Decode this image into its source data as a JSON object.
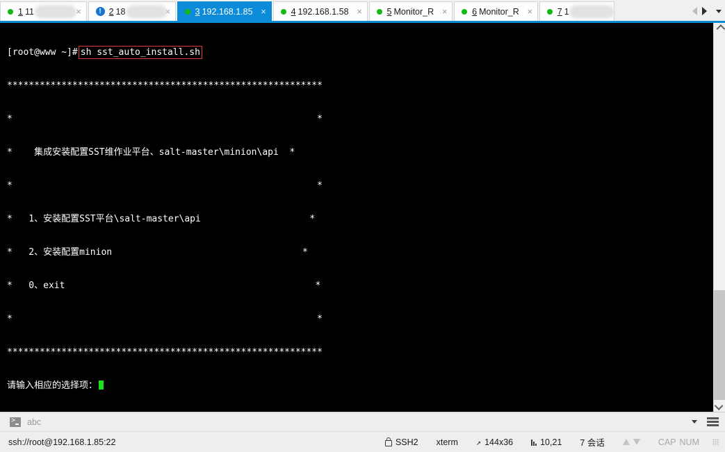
{
  "tabbar": {
    "tabs": [
      {
        "index": "1",
        "label_prefix": "11",
        "label_suffix": ".171",
        "redacted": true,
        "icon": "status-dot-green",
        "close": "×",
        "active": false
      },
      {
        "index": "2",
        "label_prefix": "18",
        "label_suffix": "180",
        "redacted": true,
        "icon": "warning-blue",
        "close": "×",
        "active": false
      },
      {
        "index": "3",
        "label_prefix": "192.168.1.85",
        "label_suffix": "",
        "redacted": false,
        "icon": "status-dot-green",
        "close": "×",
        "active": true
      },
      {
        "index": "4",
        "label_prefix": "192.168.1.58",
        "label_suffix": "",
        "redacted": false,
        "icon": "status-dot-green",
        "close": "×",
        "active": false
      },
      {
        "index": "5",
        "label_prefix": "Monitor_R",
        "label_suffix": "",
        "redacted": false,
        "icon": "status-dot-green",
        "close": "×",
        "active": false
      },
      {
        "index": "6",
        "label_prefix": "Monitor_R",
        "label_suffix": "",
        "redacted": false,
        "icon": "status-dot-green",
        "close": "×",
        "active": false
      },
      {
        "index": "7",
        "label_prefix": "1",
        "label_suffix": "4",
        "redacted": true,
        "icon": "status-dot-green",
        "close": "×",
        "active": false
      }
    ],
    "nav": {
      "prev": "scroll-tabs-left",
      "next": "scroll-tabs-right",
      "list": "tab-list-dropdown"
    },
    "active_color": "#0b8bd8",
    "status_dot_color": "#14b814"
  },
  "terminal": {
    "prompt": "[root@www ~]#",
    "command": "sh sst_auto_install.sh",
    "highlight_color": "#e03a34",
    "border_line": "**********************************************************",
    "lines": [
      "*                                                        *",
      "*    集成安装配置SST维作业平台、salt-master\\minion\\api  *",
      "*                                                        *",
      "*   1、安装配置SST平台\\salt-master\\api                    *",
      "*   2、安装配置minion                                   *",
      "*   0、exit                                              *",
      "*                                                        *"
    ],
    "input_prompt": "请输入相应的选择项：",
    "cursor_color": "#19e019",
    "bg_color": "#000000",
    "fg_color": "#ffffff"
  },
  "command_bar": {
    "icon": "console-icon",
    "placeholder": "abc",
    "value": "",
    "dropdown": "command-history-dropdown",
    "menu": "command-bar-menu"
  },
  "statusbar": {
    "connection": "ssh://root@192.168.1.85:22",
    "protocol": "SSH2",
    "terminal_type": "xterm",
    "dimensions": "144x36",
    "cursor_position": "10,21",
    "sessions": "7 会话",
    "cap": "CAP",
    "num": "NUM"
  }
}
